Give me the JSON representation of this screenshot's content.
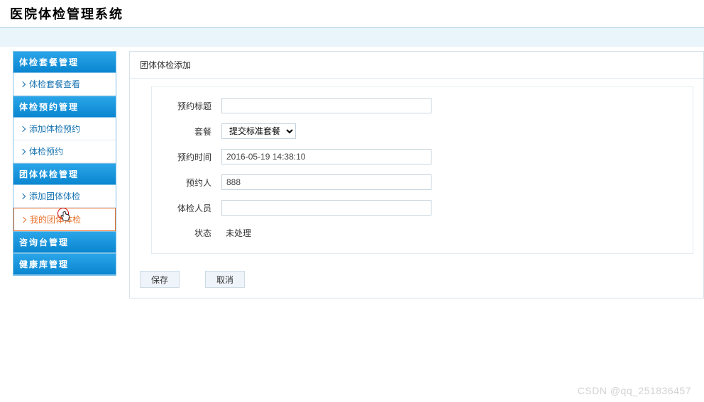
{
  "page_title": "医院体检管理系统",
  "sidebar": {
    "groups": [
      {
        "header": "体检套餐管理",
        "items": [
          {
            "label": "体检套餐查看",
            "name": "nav-package-view"
          }
        ]
      },
      {
        "header": "体检预约管理",
        "items": [
          {
            "label": "添加体检预约",
            "name": "nav-add-exam-reservation"
          },
          {
            "label": "体检预约",
            "name": "nav-exam-reservation"
          }
        ]
      },
      {
        "header": "团体体检管理",
        "items": [
          {
            "label": "添加团体体检",
            "name": "nav-add-group-exam"
          },
          {
            "label": "我的团体体检",
            "name": "nav-my-group-exam",
            "active": true
          }
        ]
      },
      {
        "header": "咨询台管理",
        "items": []
      },
      {
        "header": "健康库管理",
        "items": []
      }
    ]
  },
  "main": {
    "title": "团体体检添加",
    "form": {
      "reservation_title": {
        "label": "预约标题",
        "value": ""
      },
      "package": {
        "label": "套餐",
        "options": [
          "提交标准套餐"
        ],
        "selected": "提交标准套餐"
      },
      "reservation_time": {
        "label": "预约时间",
        "value": "2016-05-19 14:38:10"
      },
      "reserver": {
        "label": "预约人",
        "value": "888"
      },
      "staff": {
        "label": "体检人员",
        "value": ""
      },
      "status": {
        "label": "状态",
        "value": "未处理"
      }
    },
    "buttons": {
      "save": "保存",
      "cancel": "取消"
    }
  },
  "watermark": "CSDN @qq_251836457"
}
